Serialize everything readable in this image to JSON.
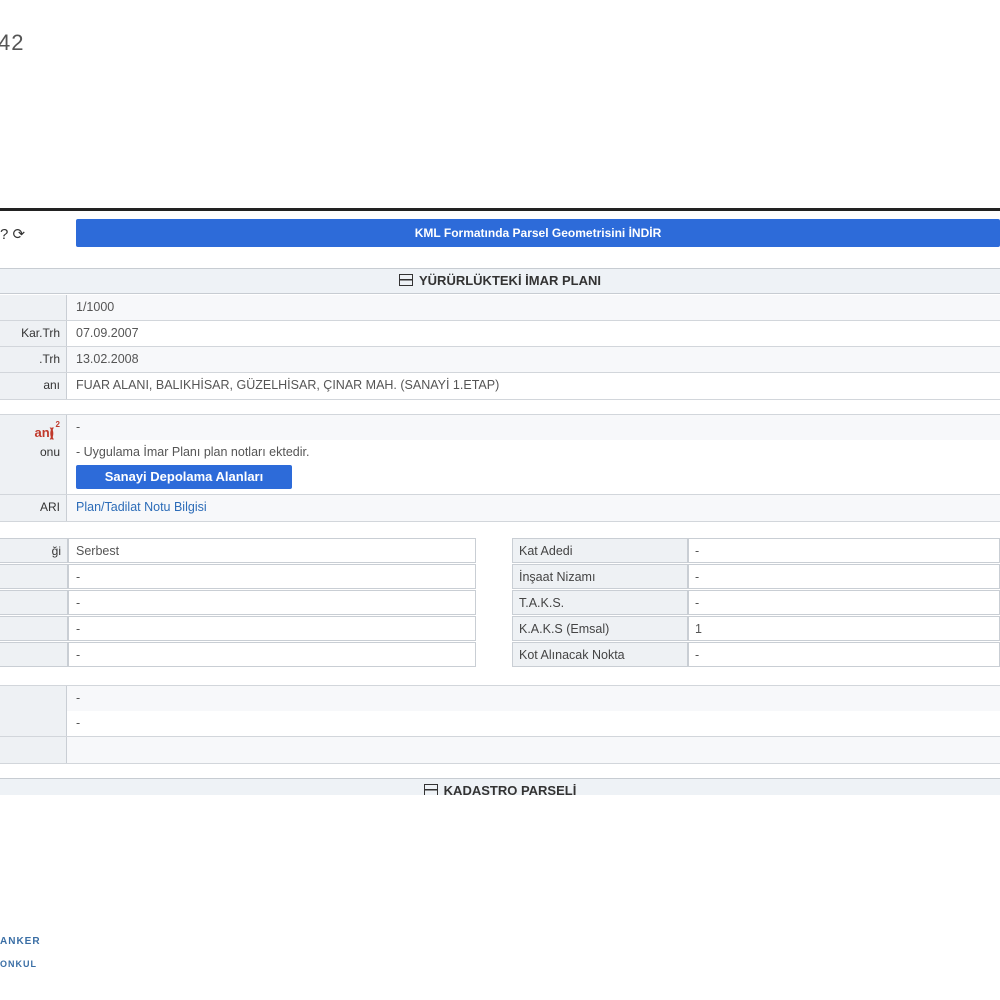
{
  "corner_number": "42",
  "watermark": {
    "line1": "ANKER",
    "line2": "ONKUL"
  },
  "header": {
    "icons_label": "? ⟳",
    "kml_button": "KML Formatında Parsel Geometrisini İNDİR"
  },
  "imar": {
    "section_title": "YÜRÜRLÜKTEKİ İMAR PLANI",
    "rows": [
      {
        "label": "",
        "value": "1/1000"
      },
      {
        "label": "Kar.Trh",
        "value": "07.09.2007"
      },
      {
        "label": ".Trh",
        "value": "13.02.2008"
      },
      {
        "label": "anı",
        "value": "FUAR ALANI, BALIKHİSAR, GÜZELHİSAR, ÇINAR MAH. (SANAYİ 1.ETAP)"
      }
    ],
    "area_label": "an(",
    "area_sup": "2",
    "area_label_end": ")",
    "area_value": "-",
    "notes_label": "onu",
    "notes_text": "- Uygulama İmar Planı plan notları ektedir.",
    "notes_button": "Sanayi Depolama Alanları",
    "ari_label": "ARI",
    "ari_link": "Plan/Tadilat Notu Bilgisi"
  },
  "left_grid": [
    {
      "label": "ği",
      "value": "Serbest"
    },
    {
      "label": "",
      "value": "-"
    },
    {
      "label": "",
      "value": "-"
    },
    {
      "label": "",
      "value": "-"
    },
    {
      "label": "",
      "value": "-"
    }
  ],
  "right_grid": [
    {
      "label": "Kat Adedi",
      "value": "-"
    },
    {
      "label": "İnşaat Nizamı",
      "value": "-"
    },
    {
      "label": "T.A.K.S.",
      "value": "-"
    },
    {
      "label": "K.A.K.S (Emsal)",
      "value": "1"
    },
    {
      "label": "Kot Alınacak Nokta",
      "value": "-"
    }
  ],
  "bottom_rows": [
    {
      "label": "",
      "value": "-"
    },
    {
      "label": "",
      "value": "-"
    },
    {
      "label": "",
      "value": ""
    }
  ],
  "kadastro": {
    "section_title": "KADASTRO PARSELİ"
  }
}
